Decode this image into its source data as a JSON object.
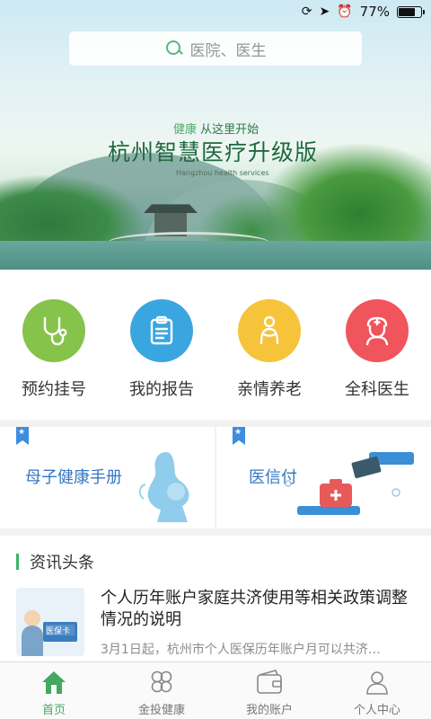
{
  "status_bar": {
    "battery": "77%",
    "battery_level": 0.77
  },
  "search": {
    "placeholder": "医院、医生"
  },
  "banner": {
    "tag_highlight": "健康",
    "tag_rest": "从这里开始",
    "title": "杭州智慧医疗升级版",
    "subtitle": "Hangzhou health services"
  },
  "quick_menu": [
    {
      "label": "预约挂号",
      "icon": "stethoscope-icon",
      "color": "#86c34b"
    },
    {
      "label": "我的报告",
      "icon": "clipboard-icon",
      "color": "#3aa6e0"
    },
    {
      "label": "亲情养老",
      "icon": "elder-care-icon",
      "color": "#f5c43b"
    },
    {
      "label": "全科医生",
      "icon": "doctor-icon",
      "color": "#f0545d"
    }
  ],
  "cards": [
    {
      "title": "母子健康手册",
      "icon": "bookmark-icon"
    },
    {
      "title": "医信付",
      "icon": "bookmark-icon"
    }
  ],
  "news": {
    "heading": "资讯头条",
    "items": [
      {
        "title": "个人历年账户家庭共济使用等相关政策调整情况的说明",
        "desc": "3月1日起，杭州市个人医保历年账户月可以共济…",
        "thumb_text": "医保卡"
      }
    ]
  },
  "tabs": [
    {
      "label": "首页",
      "icon": "home-icon",
      "active": true
    },
    {
      "label": "金投健康",
      "icon": "clover-icon",
      "active": false
    },
    {
      "label": "我的账户",
      "icon": "wallet-icon",
      "active": false
    },
    {
      "label": "个人中心",
      "icon": "person-icon",
      "active": false
    }
  ],
  "colors": {
    "accent": "#43a860",
    "link": "#3577c4"
  }
}
